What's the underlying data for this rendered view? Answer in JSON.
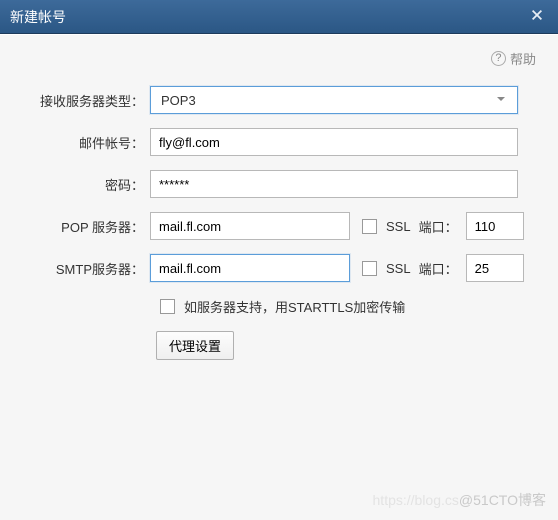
{
  "titlebar": {
    "title": "新建帐号"
  },
  "help": {
    "label": "帮助"
  },
  "form": {
    "server_type_label": "接收服务器类型：",
    "server_type_value": "POP3",
    "account_label": "邮件帐号：",
    "account_value": "fly@fl.com",
    "password_label": "密码：",
    "password_value": "******",
    "pop_label": "POP 服务器：",
    "pop_value": "mail.fl.com",
    "pop_ssl_label": "SSL",
    "pop_port_label": "端口：",
    "pop_port_value": "110",
    "smtp_label": "SMTP服务器：",
    "smtp_value": "mail.fl.com",
    "smtp_ssl_label": "SSL",
    "smtp_port_label": "端口：",
    "smtp_port_value": "25",
    "starttls_label": "如服务器支持，用STARTTLS加密传输",
    "proxy_button": "代理设置"
  },
  "watermark": {
    "prefix": "https://blog.cs",
    "main": "@51CTO博客"
  }
}
